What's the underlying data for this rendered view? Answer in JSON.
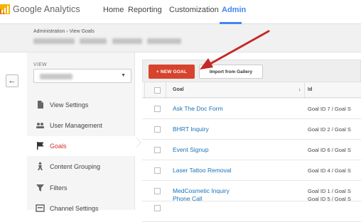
{
  "header": {
    "logo_text": "Google Analytics",
    "nav": [
      {
        "label": "Home"
      },
      {
        "label": "Reporting"
      },
      {
        "label": "Customization"
      },
      {
        "label": "Admin"
      }
    ],
    "active_nav": "Admin"
  },
  "breadcrumb": {
    "text": "Administration › View Goals"
  },
  "sidebar": {
    "back_icon": "←",
    "view_label": "VIEW",
    "items": [
      {
        "label": "View Settings",
        "icon": "document-icon"
      },
      {
        "label": "User Management",
        "icon": "users-icon"
      },
      {
        "label": "Goals",
        "icon": "flag-icon"
      },
      {
        "label": "Content Grouping",
        "icon": "person-icon"
      },
      {
        "label": "Filters",
        "icon": "filter-icon"
      },
      {
        "label": "Channel Settings",
        "icon": "channel-icon"
      }
    ],
    "active_item": "Goals"
  },
  "toolbar": {
    "new_goal_label": "+ NEW GOAL",
    "import_label": "Import from Gallery"
  },
  "table": {
    "columns": [
      "Goal",
      "Id"
    ],
    "sort_indicator": "↓",
    "rows": [
      {
        "goal": "Ask The Doc Form",
        "id": "Goal ID 7 / Goal S"
      },
      {
        "goal": "BHRT Inquiry",
        "id": "Goal ID 2 / Goal S"
      },
      {
        "goal": "Event Signup",
        "id": "Goal ID 6 / Goal S"
      },
      {
        "goal": "Laser Tattoo Removal",
        "id": "Goal ID 4 / Goal S"
      },
      {
        "goal": "MedCosmetic Inquiry",
        "id": "Goal ID 1 / Goal S"
      },
      {
        "goal": "Phone Call",
        "id": "Goal ID 5 / Goal S"
      }
    ]
  },
  "colors": {
    "accent": "#4285f4",
    "new_goal_button": "#d6442e",
    "active_item": "#d32f2f",
    "link": "#1a73b8",
    "arrow": "#c62828"
  }
}
